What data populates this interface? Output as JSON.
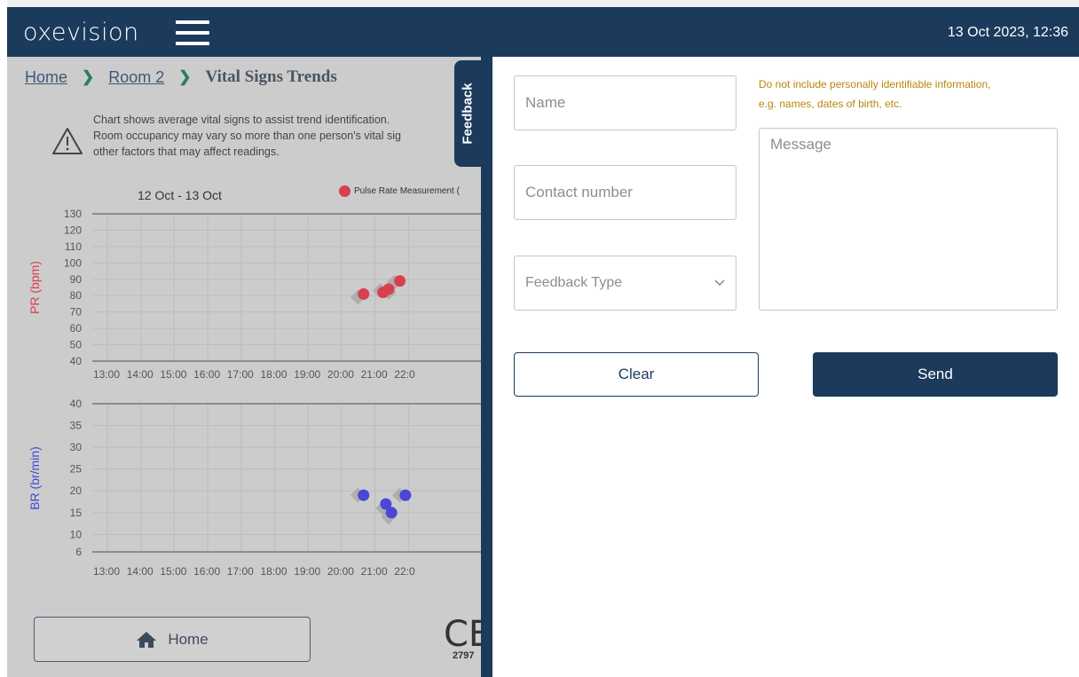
{
  "header": {
    "logo": "oxevision",
    "datetime": "13 Oct 2023, 12:36"
  },
  "breadcrumb": {
    "home": "Home",
    "room": "Room 2",
    "current": "Vital Signs Trends"
  },
  "notice": {
    "line1": "Chart shows average vital signs to assist trend identification.",
    "line2": "Room occupancy may vary so more than one person's vital sig",
    "line3": "other factors that may affect readings."
  },
  "chart_data": [
    {
      "type": "scatter",
      "title": "12 Oct - 13 Oct",
      "ylabel": "PR (bpm)",
      "ylim": [
        40,
        130
      ],
      "yticks": [
        130,
        120,
        110,
        100,
        90,
        80,
        70,
        60,
        50,
        40
      ],
      "xticks": [
        "13:00",
        "14:00",
        "15:00",
        "16:00",
        "17:00",
        "18:00",
        "19:00",
        "20:00",
        "21:00",
        "22:0"
      ],
      "legend": "Pulse Rate Measurement (",
      "color": "#d9404e",
      "series": [
        {
          "name": "Pulse Rate Measurement",
          "x": [
            "21:05",
            "21:40",
            "21:50",
            "22:10"
          ],
          "y": [
            81,
            82,
            84,
            89
          ]
        }
      ],
      "gray_points": {
        "x": [
          "20:55",
          "21:35",
          "21:50",
          "22:00"
        ],
        "y": [
          79,
          83,
          82,
          88
        ]
      }
    },
    {
      "type": "scatter",
      "ylabel": "BR (br/min)",
      "ylim": [
        6,
        40
      ],
      "yticks": [
        40,
        35,
        30,
        25,
        20,
        15,
        10,
        6
      ],
      "xticks": [
        "13:00",
        "14:00",
        "15:00",
        "16:00",
        "17:00",
        "18:00",
        "19:00",
        "20:00",
        "21:00",
        "22:0"
      ],
      "color": "#4a46d6",
      "series": [
        {
          "x": [
            "21:05",
            "21:45",
            "21:55",
            "22:20"
          ],
          "y": [
            19,
            17,
            15,
            19
          ]
        }
      ],
      "gray_points": {
        "x": [
          "20:55",
          "21:40",
          "21:50",
          "22:10"
        ],
        "y": [
          19,
          16,
          14,
          19
        ]
      }
    }
  ],
  "home_button": {
    "label": "Home"
  },
  "certification": {
    "mark": "CE",
    "code": "2797"
  },
  "feedback": {
    "tab_label": "Feedback",
    "name_placeholder": "Name",
    "contact_placeholder": "Contact number",
    "type_placeholder": "Feedback Type",
    "message_placeholder": "Message",
    "privacy_line1": "Do not include personally identifiable information,",
    "privacy_line2": "e.g. names, dates of birth, etc.",
    "clear_label": "Clear",
    "send_label": "Send"
  }
}
